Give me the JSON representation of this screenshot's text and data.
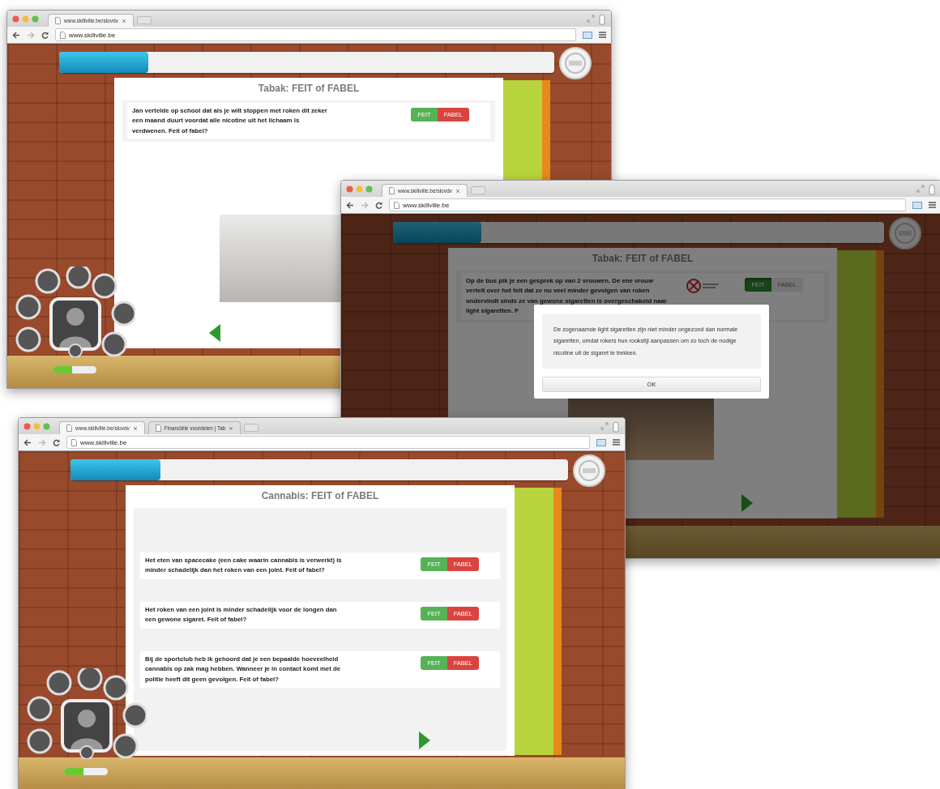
{
  "windows": [
    {
      "tabs": [
        {
          "label": "www.skillville.be/slovdv",
          "selected": true
        }
      ],
      "url": "www.skillville.be",
      "progress": {
        "level": 0.18
      },
      "card": {
        "title": "Tabak: FEIT of FABEL",
        "questions": [
          {
            "text": "Jan vertelde op school dat als je wilt stoppen met roken dit zeker een maand duurt voordat alle nicotine uit het lichaam is verdwenen. Feit of fabel?",
            "logo": false,
            "buttons": [
              {
                "label": "FEIT",
                "selected": false
              },
              {
                "label": "FABEL",
                "selected": false
              }
            ]
          }
        ],
        "photo": true,
        "nav_arrow": {
          "kind": "left"
        }
      },
      "menu": {
        "level": 0.45
      }
    },
    {
      "tabs": [
        {
          "label": "www.skillville.be/slovdv",
          "selected": true
        }
      ],
      "url": "www.skillville.be",
      "progress": {
        "level": 0.18
      },
      "card": {
        "title": "Tabak: FEIT of FABEL",
        "questions": [
          {
            "text": "Op de bus pik je een gesprek op van 2 vrouwen. De ene vrouw vertelt over het feit dat ze nu veel minder gevolgen van roken ondervindt sinds ze van gewone sigaretten is overgeschakeld naar light sigaretten. F",
            "logo": true,
            "buttons": [
              {
                "label": "FEIT",
                "selected": true
              },
              {
                "label": "FABEL",
                "selected": false
              }
            ]
          }
        ],
        "photo": true,
        "nav_arrow": {
          "kind": "right"
        }
      },
      "modal": {
        "text": "De zogenaamde light sigaretten zijn niet minder ongezond dan normale sigaretten, omdat rokers hun rookstijl aanpassen om zo toch de nodige nicotine uit de sigaret te trekken.",
        "button": "OK"
      }
    },
    {
      "tabs": [
        {
          "label": "www.skillville.be/slovdv",
          "selected": true
        },
        {
          "label": "Financiële voordelen | Tab",
          "selected": false
        }
      ],
      "url": "www.skillville.be",
      "progress": {
        "level": 0.18
      },
      "card": {
        "title": "Cannabis: FEIT of FABEL",
        "questions": [
          {
            "text": "Het eten van spacecake (een cake waarin cannabis is verwerkt) is minder schadelijk dan het roken van een joint. Feit of fabel?",
            "logo": false,
            "buttons": [
              {
                "label": "FEIT",
                "selected": false
              },
              {
                "label": "FABEL",
                "selected": false
              }
            ]
          },
          {
            "text": "Het roken van een joint is minder schadelijk voor de longen dan een gewone sigaret. Feit of fabel?",
            "logo": false,
            "buttons": [
              {
                "label": "FEIT",
                "selected": false
              },
              {
                "label": "FABEL",
                "selected": false
              }
            ]
          },
          {
            "text": "Bij de sportclub heb ik gehoord dat je een bepaalde hoeveelheid cannabis op zak mag hebben. Wanneer je in contact komt met de politie heeft dit geen gevolgen. Feit of fabel?",
            "logo": false,
            "buttons": [
              {
                "label": "FEIT",
                "selected": false
              },
              {
                "label": "FABEL",
                "selected": false
              }
            ]
          }
        ],
        "photo": false,
        "nav_arrow": {
          "kind": "right"
        }
      },
      "menu": {
        "level": 0.45
      }
    }
  ]
}
